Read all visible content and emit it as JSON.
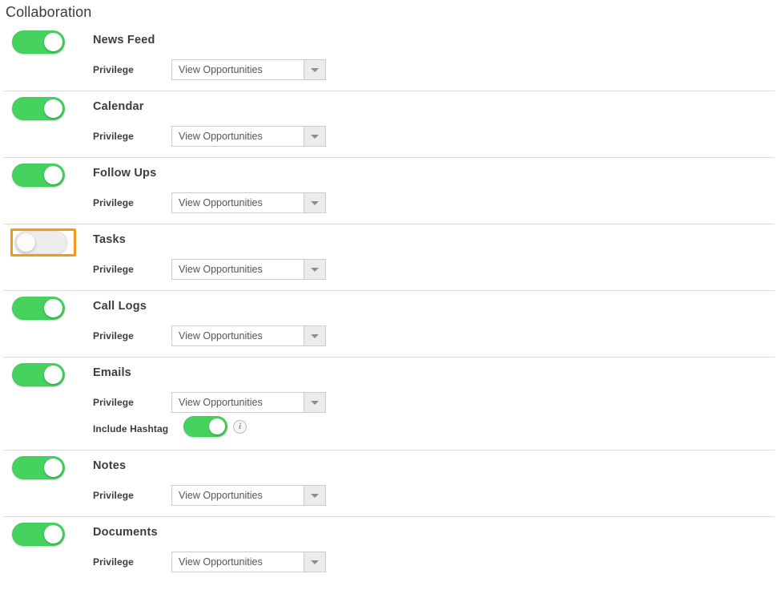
{
  "section": {
    "title": "Collaboration"
  },
  "colors": {
    "toggle_on": "#45d25f",
    "toggle_off": "#ededed",
    "highlight_border": "#f3981d",
    "divider": "#dcdcdc",
    "text": "#3d3d3d"
  },
  "labels": {
    "privilege": "Privilege",
    "include_hashtag": "Include Hashtag",
    "info_glyph": "i"
  },
  "rows": [
    {
      "name": "News Feed",
      "enabled": true,
      "highlighted": false,
      "privilege_label": "Privilege",
      "privilege_value": "View Opportunities"
    },
    {
      "name": "Calendar",
      "enabled": true,
      "highlighted": false,
      "privilege_label": "Privilege",
      "privilege_value": "View Opportunities"
    },
    {
      "name": "Follow Ups",
      "enabled": true,
      "highlighted": false,
      "privilege_label": "Privilege",
      "privilege_value": "View Opportunities"
    },
    {
      "name": "Tasks",
      "enabled": false,
      "highlighted": true,
      "privilege_label": "Privilege",
      "privilege_value": "View Opportunities"
    },
    {
      "name": "Call Logs",
      "enabled": true,
      "highlighted": false,
      "privilege_label": "Privilege",
      "privilege_value": "View Opportunities"
    },
    {
      "name": "Emails",
      "enabled": true,
      "highlighted": false,
      "privilege_label": "Privilege",
      "privilege_value": "View Opportunities",
      "sub_label": "Include Hashtag",
      "sub_enabled": true,
      "sub_info": "i"
    },
    {
      "name": "Notes",
      "enabled": true,
      "highlighted": false,
      "privilege_label": "Privilege",
      "privilege_value": "View Opportunities"
    },
    {
      "name": "Documents",
      "enabled": true,
      "highlighted": false,
      "privilege_label": "Privilege",
      "privilege_value": "View Opportunities"
    }
  ]
}
